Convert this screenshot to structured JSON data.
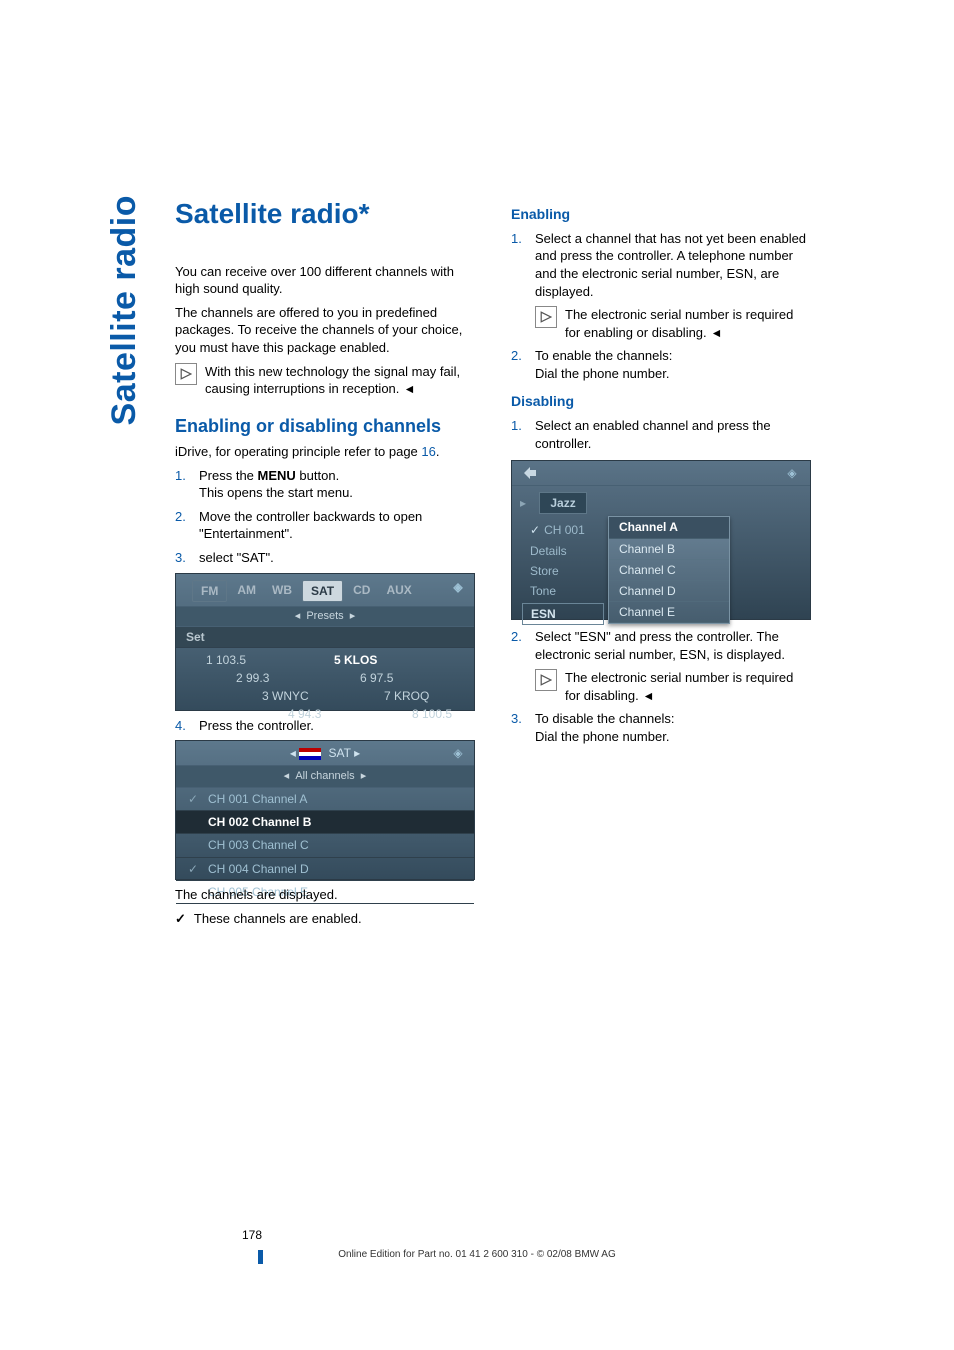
{
  "side_label": "Satellite radio",
  "title": "Satellite radio*",
  "left": {
    "intro1": "You can receive over 100 different channels with high sound quality.",
    "intro2": "The channels are offered to you in predefined packages. To receive the channels of your choice, you must have this package enabled.",
    "note1": "With this new technology the signal may fail, causing interruptions in reception.",
    "section_heading": "Enabling or disabling channels",
    "idrive_pre": "iDrive, for operating principle refer to page ",
    "idrive_page": "16",
    "idrive_post": ".",
    "step1a": "Press the ",
    "step1_menu": "MENU",
    "step1b": " button.",
    "step1c": "This opens the start menu.",
    "step2": "Move the controller backwards to open \"Entertainment\".",
    "step3": "select \"SAT\".",
    "step4": "Press the controller.",
    "below_img": "The channels are displayed.",
    "check_note": "These channels are enabled."
  },
  "right": {
    "enabling_h": "Enabling",
    "en_step1": "Select a channel that has not yet been enabled and press the controller. A telephone number and the electronic serial number, ESN, are displayed.",
    "en_note": "The electronic serial number is required for enabling or disabling.",
    "en_step2a": "To enable the channels:",
    "en_step2b": "Dial the phone number.",
    "disabling_h": "Disabling",
    "di_step1": "Select an enabled channel and press the controller.",
    "di_step2": "Select \"ESN\" and press the controller. The electronic serial number, ESN, is displayed.",
    "di_note": "The electronic serial number is required for disabling.",
    "di_step3a": "To disable the channels:",
    "di_step3b": "Dial the phone number."
  },
  "shotA": {
    "tabs": {
      "fm": "FM",
      "am": "AM",
      "wb": "WB",
      "sat": "SAT",
      "cd": "CD",
      "aux": "AUX"
    },
    "presets_label": "Presets",
    "set_label": "Set",
    "p1": "1 103.5",
    "p2": "2 99.3",
    "p3": "3 WNYC",
    "p4": "4 94.3",
    "p5": "5 KLOS",
    "p6": "6 97.5",
    "p7": "7 KROQ",
    "p8": "8 100.5"
  },
  "shotB": {
    "sat": "SAT",
    "all": "All channels",
    "rows": {
      "r1": "CH 001 Channel A",
      "r2": "CH 002 Channel B",
      "r3": "CH 003 Channel C",
      "r4": "CH 004 Channel D",
      "r5": "CH 005 Channel E"
    }
  },
  "shotC": {
    "jazz": "Jazz",
    "side": {
      "s1": "CH 001",
      "s2": "Details",
      "s3": "Store",
      "s4": "Tone",
      "s5": "ESN"
    },
    "popup": {
      "p1": "Channel A",
      "p2": "Channel B",
      "p3": "Channel C",
      "p4": "Channel D",
      "p5": "Channel E"
    }
  },
  "footer": {
    "page": "178",
    "line": "Online Edition for Part no. 01 41 2 600 310 - © 02/08 BMW AG"
  },
  "nums": {
    "n1": "1.",
    "n2": "2.",
    "n3": "3.",
    "n4": "4."
  },
  "glyphs": {
    "check": "✓",
    "larr": "◂",
    "rarr": "▸"
  }
}
